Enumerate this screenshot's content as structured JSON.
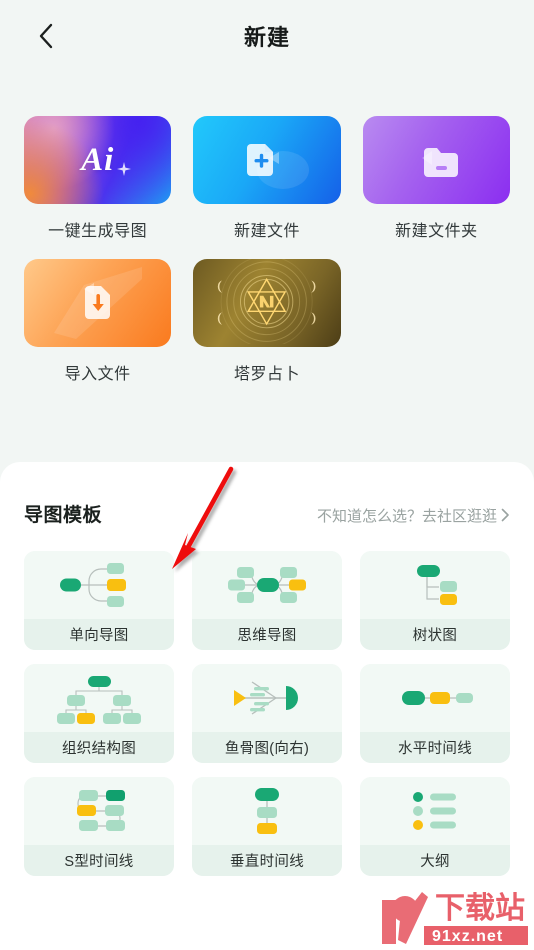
{
  "header": {
    "back_icon": "chevron-left-icon",
    "title": "新建"
  },
  "entries": [
    {
      "id": "ai-generate",
      "label": "一键生成导图",
      "icon": "ai-sparkle-icon",
      "glyph": "Ai"
    },
    {
      "id": "new-file",
      "label": "新建文件",
      "icon": "document-plus-icon",
      "glyph": ""
    },
    {
      "id": "new-folder",
      "label": "新建文件夹",
      "icon": "folder-icon",
      "glyph": ""
    },
    {
      "id": "import-file",
      "label": "导入文件",
      "icon": "file-download-icon",
      "glyph": ""
    },
    {
      "id": "tarot",
      "label": "塔罗占卜",
      "icon": "tarot-hexagram-icon",
      "glyph": ""
    }
  ],
  "templates_section": {
    "title": "导图模板",
    "link_text": "不知道怎么选？去社区逛逛",
    "link_chevron": "chevron-right-icon"
  },
  "templates": [
    {
      "id": "one-way-map",
      "label": "单向导图",
      "icon": "one-way-map-icon"
    },
    {
      "id": "mind-map",
      "label": "思维导图",
      "icon": "mind-map-icon"
    },
    {
      "id": "tree-map",
      "label": "树状图",
      "icon": "tree-map-icon"
    },
    {
      "id": "org-chart",
      "label": "组织结构图",
      "icon": "org-chart-icon"
    },
    {
      "id": "fishbone-right",
      "label": "鱼骨图(向右)",
      "icon": "fishbone-right-icon"
    },
    {
      "id": "timeline-h",
      "label": "水平时间线",
      "icon": "horizontal-timeline-icon"
    },
    {
      "id": "timeline-s",
      "label": "S型时间线",
      "icon": "s-timeline-icon"
    },
    {
      "id": "timeline-v",
      "label": "垂直时间线",
      "icon": "vertical-timeline-icon"
    },
    {
      "id": "outline",
      "label": "大纲",
      "icon": "outline-list-icon"
    }
  ],
  "annotation": {
    "arrow_color": "#ee1111",
    "target": "单向导图"
  },
  "watermark": {
    "text_main": "下载站",
    "text_sub": "91xz.net",
    "logo": "91",
    "color": "#e8606a"
  },
  "colors": {
    "page_background": "#f2f6f4",
    "panel_background": "#ffffff",
    "title_text": "#161a19",
    "muted_text": "#9aa3a1",
    "template_card": "#f2f9f5",
    "template_label_bar": "#e6f2ec",
    "node_green": "#1aa874",
    "node_green_light": "#a8dcc4",
    "node_orange": "#f9bf10"
  }
}
